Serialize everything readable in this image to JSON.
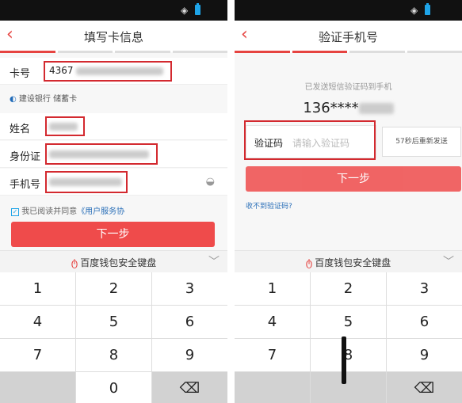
{
  "left": {
    "title": "填写卡信息",
    "card_label": "卡号",
    "card_prefix": "4367",
    "bank_name": "建设银行 储蓄卡",
    "name_label": "姓名",
    "id_label": "身份证",
    "phone_label": "手机号",
    "agree_text": "我已阅读并同意",
    "agree_link": "《用户服务协",
    "next_label": "下一步"
  },
  "right": {
    "title": "验证手机号",
    "hint": "已发送短信验证码到手机",
    "phone_prefix": "136****",
    "code_label": "验证码",
    "code_placeholder": "请输入验证码",
    "countdown": "57秒后重新发送",
    "next_label": "下一步",
    "no_code_link": "收不到验证码?"
  },
  "keyboard": {
    "title": "百度钱包安全键盘",
    "keys": [
      "1",
      "2",
      "3",
      "4",
      "5",
      "6",
      "7",
      "8",
      "9",
      "0"
    ],
    "delete_symbol": "⌫",
    "chevron": "﹀",
    "logo": "ტ"
  },
  "status": {
    "wifi": "◈"
  },
  "icons": {
    "back": "‹",
    "checkbox": "✓",
    "bank": "◐",
    "eye": "◒"
  },
  "colors": {
    "accent": "#ef4b4b",
    "red_box": "#d3292f"
  }
}
